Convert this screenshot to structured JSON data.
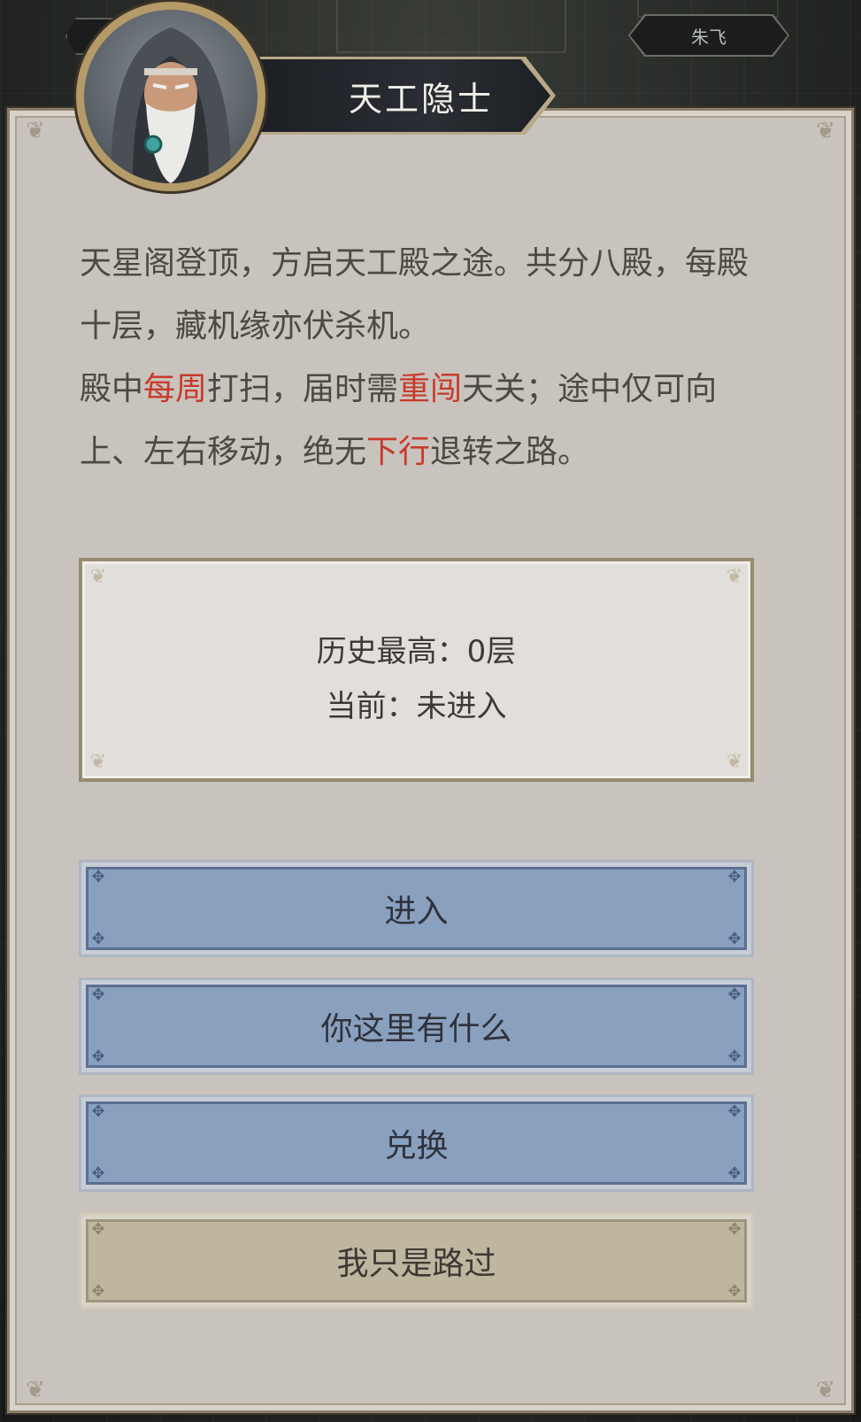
{
  "npc": {
    "name": "天工隐士"
  },
  "top_tag": {
    "right_label": "朱飞"
  },
  "description": {
    "p1": "天星阁登顶，方启天工殿之途。共分八殿，每殿十层，藏机缘亦伏杀机。",
    "p2_a": "殿中",
    "p2_red1": "每周",
    "p2_b": "打扫，届时需",
    "p2_red2": "重闯",
    "p2_c": "天关；途中仅可向上、左右移动，绝无",
    "p2_red3": "下行",
    "p2_d": "退转之路。"
  },
  "record": {
    "best": "历史最高：0层",
    "current": "当前：未进入"
  },
  "buttons": {
    "enter": "进入",
    "shop": "你这里有什么",
    "exchange": "兑换",
    "pass": "我只是路过"
  },
  "colors": {
    "highlight_red": "#c83a2c",
    "button_blue": "#8aa0bf",
    "button_tan": "#bfb6a0",
    "panel_bg": "#c9c3bd"
  }
}
